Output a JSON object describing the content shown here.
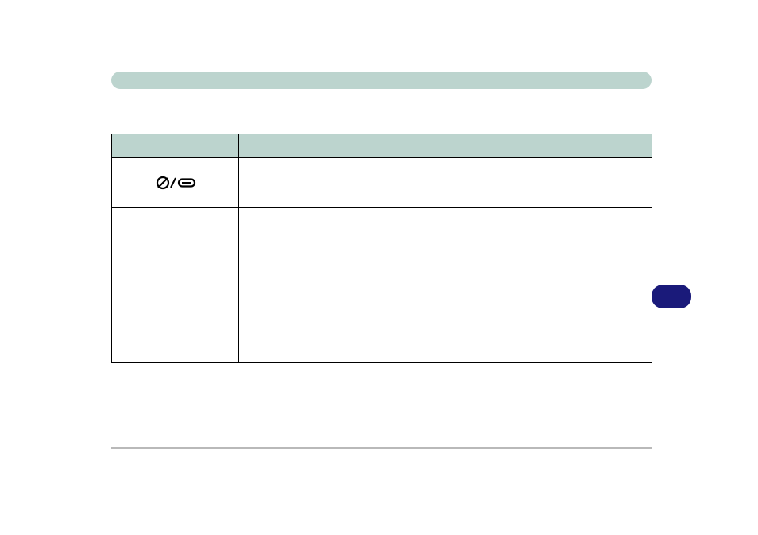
{
  "header": {
    "title": ""
  },
  "table": {
    "columns": [
      {
        "label": ""
      },
      {
        "label": ""
      }
    ],
    "rows": [
      {
        "left_icon": "slashed-zero-and-rounded-rect-icon",
        "left": "",
        "right": ""
      },
      {
        "left": "",
        "right": ""
      },
      {
        "left": "",
        "right": ""
      },
      {
        "left": "",
        "right": ""
      }
    ]
  },
  "side_tab": {
    "label": ""
  },
  "footer_rule": true,
  "colors": {
    "bar": "#bcd4ce",
    "tab": "#1a1a7a",
    "rule": "#b9b9b9",
    "border": "#000000"
  }
}
